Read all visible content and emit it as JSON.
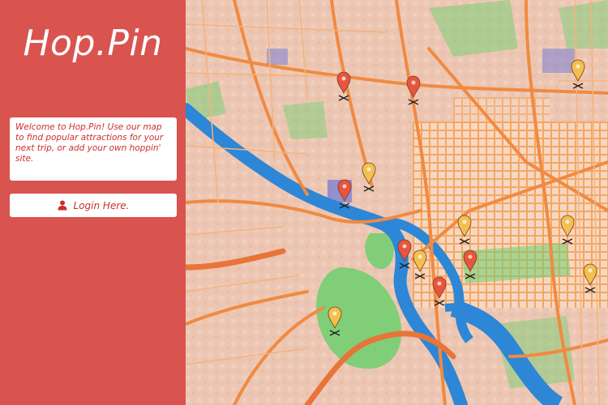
{
  "app": {
    "logo_text": "Hop.Pin"
  },
  "sidebar": {
    "welcome_text": "Welcome to Hop.Pin! Use our map to find popular attractions for your next trip, or add your own hoppin' site.",
    "login_label": "Login Here.",
    "login_icon": "user-icon"
  },
  "map": {
    "pin_icon": "map-pin-icon",
    "pin_colors": {
      "red": "#e8553e",
      "yellow": "#f2c04e"
    },
    "pins": [
      {
        "color": "red"
      },
      {
        "color": "red"
      },
      {
        "color": "yellow"
      },
      {
        "color": "yellow"
      },
      {
        "color": "red"
      },
      {
        "color": "yellow"
      },
      {
        "color": "yellow"
      },
      {
        "color": "red"
      },
      {
        "color": "yellow"
      },
      {
        "color": "red"
      },
      {
        "color": "red"
      },
      {
        "color": "yellow"
      },
      {
        "color": "yellow"
      }
    ]
  },
  "colors": {
    "sidebar_bg": "#d9534f",
    "accent_text": "#c9302c",
    "water": "#3a8fd6",
    "park": "#6fcf6f",
    "road": "#f3a25c"
  }
}
